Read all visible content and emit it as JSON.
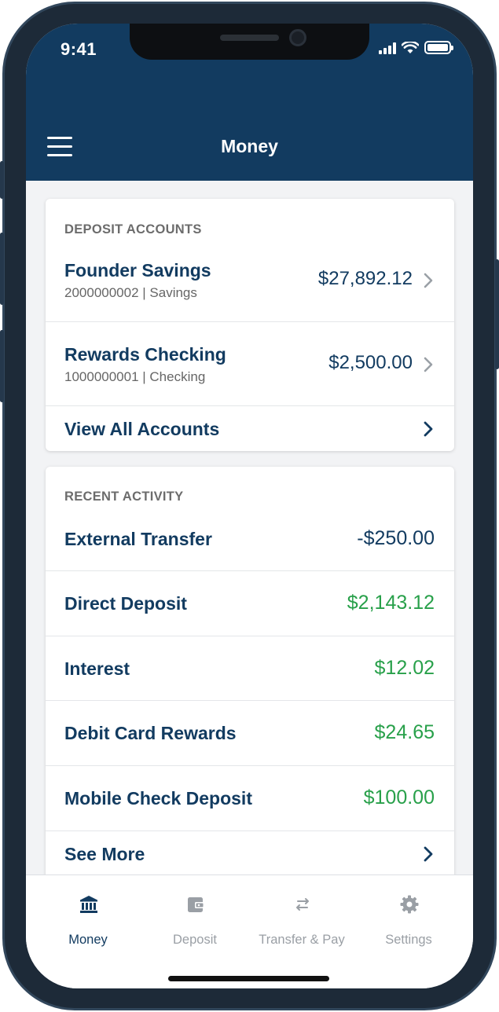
{
  "status_bar": {
    "time": "9:41"
  },
  "header": {
    "title": "Money"
  },
  "deposit_accounts": {
    "label": "DEPOSIT ACCOUNTS",
    "accounts": [
      {
        "name": "Founder Savings",
        "detail": "2000000002 | Savings",
        "balance": "$27,892.12"
      },
      {
        "name": "Rewards Checking",
        "detail": "1000000001 | Checking",
        "balance": "$2,500.00"
      }
    ],
    "view_all": "View All Accounts"
  },
  "recent_activity": {
    "label": "RECENT ACTIVITY",
    "items": [
      {
        "name": "External Transfer",
        "amount": "-$250.00",
        "type": "debit"
      },
      {
        "name": "Direct Deposit",
        "amount": "$2,143.12",
        "type": "credit"
      },
      {
        "name": "Interest",
        "amount": "$12.02",
        "type": "credit"
      },
      {
        "name": "Debit Card Rewards",
        "amount": "$24.65",
        "type": "credit"
      },
      {
        "name": "Mobile Check Deposit",
        "amount": "$100.00",
        "type": "credit"
      }
    ],
    "see_more": "See More"
  },
  "tabbar": {
    "tabs": [
      {
        "label": "Money",
        "icon": "bank-icon",
        "active": true
      },
      {
        "label": "Deposit",
        "icon": "wallet-icon",
        "active": false
      },
      {
        "label": "Transfer & Pay",
        "icon": "transfer-arrows-icon",
        "active": false
      },
      {
        "label": "Settings",
        "icon": "gear-icon",
        "active": false
      }
    ]
  },
  "colors": {
    "brand_navy": "#123b60",
    "credit_green": "#28a04a",
    "inactive_gray": "#9a9fa5"
  }
}
